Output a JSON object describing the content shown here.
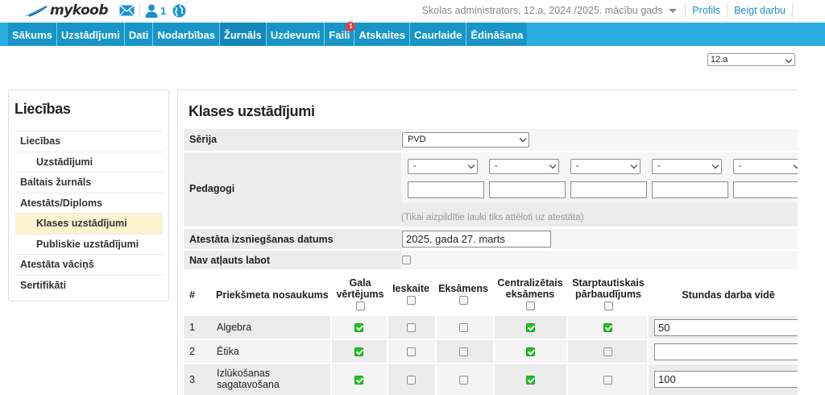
{
  "app": {
    "logo_text": "mykoob"
  },
  "topbar": {
    "user_count": "1",
    "context": "Skolas administrators, 12.a, 2024./2025. mācību gads",
    "profile_link": "Profils",
    "logout_link": "Beigt darbu"
  },
  "nav": {
    "items": [
      {
        "label": "Sākums"
      },
      {
        "label": "Uzstādījumi"
      },
      {
        "label": "Dati"
      },
      {
        "label": "Nodarbības"
      },
      {
        "label": "Žurnāls"
      },
      {
        "label": "Uzdevumi"
      },
      {
        "label": "Faili",
        "badge": "1"
      },
      {
        "label": "Atskaites"
      },
      {
        "label": "Caurlaide"
      },
      {
        "label": "Ēdināšana"
      }
    ]
  },
  "class_select": {
    "value": "12.a"
  },
  "sidebar": {
    "title": "Liecības",
    "items": [
      {
        "label": "Liecības"
      },
      {
        "label": "Uzstādījumi"
      },
      {
        "label": "Baltais žurnāls"
      },
      {
        "label": "Atestāts/Diploms"
      },
      {
        "label": "Klases uzstādījumi"
      },
      {
        "label": "Publiskie uzstādījumi"
      },
      {
        "label": "Atestāta vāciņš"
      },
      {
        "label": "Sertifikāti"
      }
    ]
  },
  "main": {
    "title": "Klases uzstādījumi",
    "series": {
      "label": "Sērija",
      "value": "PVD"
    },
    "teachers": {
      "label": "Pedagogi",
      "select_values": [
        "-",
        "-",
        "-",
        "-",
        "-"
      ],
      "names": [
        "",
        "",
        "",
        "",
        ""
      ],
      "hint": "(Tikai aizpildītie lauki tiks attēloti uz atestāta)"
    },
    "issue_date": {
      "label": "Atestāta izsniegšanas datums",
      "value": "2025. gada 27. marts"
    },
    "no_edit": {
      "label": "Nav atļauts labot"
    },
    "table": {
      "headers": {
        "num": "#",
        "name": "Priekšmeta nosaukums",
        "final_grade": "Gala vērtējums",
        "credit": "Ieskaite",
        "exam": "Eksāmens",
        "central_exam": "Centralizētais eksāmens",
        "intl_test": "Starptautiskais pārbaudījums",
        "hours": "Stundas darba vidē"
      },
      "rows": [
        {
          "num": "1",
          "name": "Algebra",
          "hours": "50"
        },
        {
          "num": "2",
          "name": "Ētika",
          "hours": ""
        },
        {
          "num": "3",
          "name": "Izlūkošanas sagatavošana",
          "hours": "100"
        }
      ]
    }
  },
  "colors": {
    "accent": "#2aaee0",
    "nav_item": "#1795c7",
    "active_sidebar": "#fdf3cf",
    "checked": "#1fc41f"
  }
}
